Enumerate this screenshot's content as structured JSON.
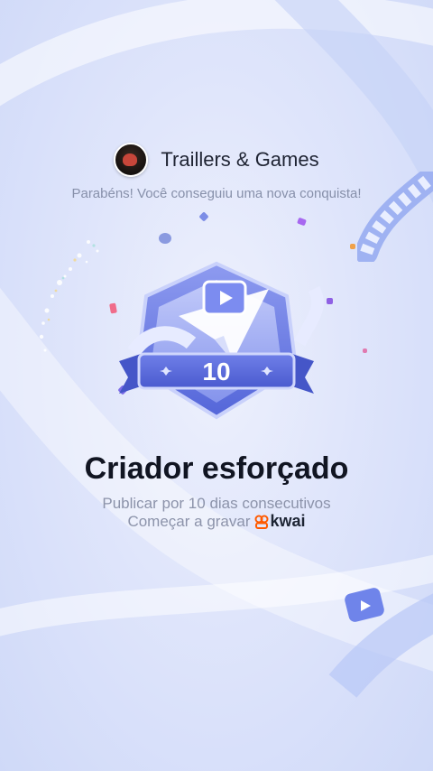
{
  "header": {
    "channel_name": "Traillers & Games"
  },
  "congrats_text": "Parabéns! Você conseguiu uma nova conquista!",
  "badge": {
    "number": "10"
  },
  "achievement": {
    "title": "Criador esforçado",
    "description": "Publicar por 10 dias consecutivos",
    "cta_text": "Começar a gravar",
    "brand": "kwai"
  },
  "colors": {
    "kwai_orange": "#ff5a00",
    "badge_purple": "#6a7be3"
  }
}
